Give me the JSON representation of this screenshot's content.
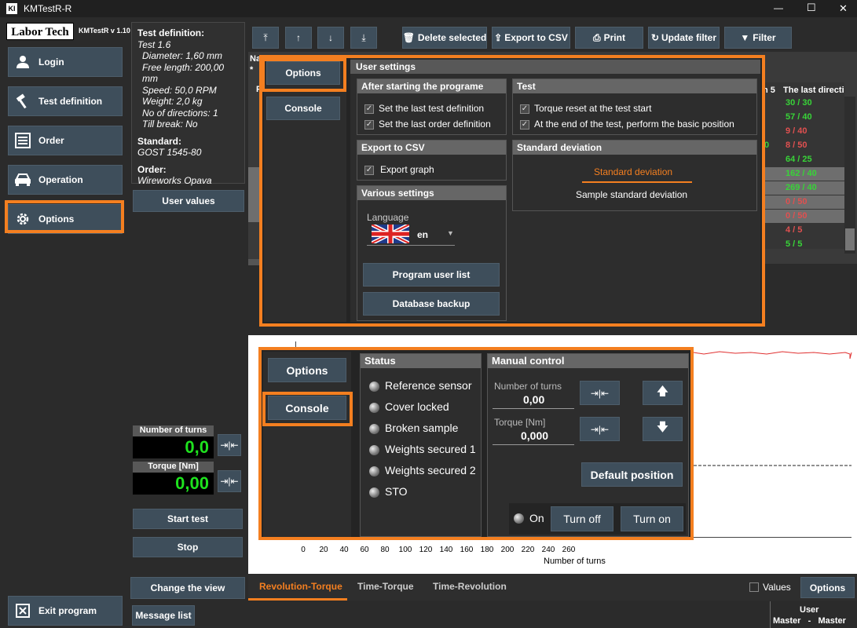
{
  "window": {
    "title": "KMTestR-R",
    "minimize": "—",
    "maximize": "☐",
    "close": "✕"
  },
  "logo": {
    "brand": "Labor Tech",
    "version": "KMTestR v 1.10"
  },
  "sidebar": {
    "items": [
      {
        "label": "Login",
        "icon": "user-icon"
      },
      {
        "label": "Test definition",
        "icon": "hammer-icon"
      },
      {
        "label": "Order",
        "icon": "order-list-icon"
      },
      {
        "label": "Operation",
        "icon": "car-icon"
      },
      {
        "label": "Options",
        "icon": "gear-icon"
      }
    ],
    "exit_label": "Exit program"
  },
  "test_info": {
    "heading": "Test definition:",
    "name": "Test 1.6",
    "diameter": "Diameter:  1,60 mm",
    "free_length": "Free length:  200,00 mm",
    "speed": "Speed:  50,0 RPM",
    "weight": "Weight:  2,0 kg",
    "directions": "No of directions:  1",
    "till_break": "Till break:  No",
    "standard_heading": "Standard:",
    "standard": "GOST 1545-80",
    "order_heading": "Order:",
    "order": "Wireworks Opava"
  },
  "user_values_label": "User values",
  "measurements": {
    "turns_label": "Number of turns",
    "turns_value": "0,0",
    "torque_label": "Torque [Nm]",
    "torque_value": "0,00"
  },
  "actions": {
    "start": "Start test",
    "stop": "Stop",
    "change_view": "Change the view",
    "message_list": "Message list"
  },
  "toolbar": {
    "delete": "Delete selected",
    "export": "Export to CSV",
    "print": "Print",
    "update": "Update filter",
    "filter": "Filter"
  },
  "table": {
    "header_partial_left": "Na",
    "header_partial_star": "*",
    "header_col_left": "F",
    "header_n5": "n 5",
    "header_last": "The last directi",
    "rows": [
      {
        "value": "30 / 30",
        "color": "#38d438",
        "extra": ""
      },
      {
        "value": "57 / 40",
        "color": "#38d438",
        "extra": ""
      },
      {
        "value": "9 / 40",
        "color": "#e05050",
        "extra": ""
      },
      {
        "value": "8 / 50",
        "color": "#e05050",
        "extra": "0"
      },
      {
        "value": "64 / 25",
        "color": "#38d438",
        "extra": ""
      },
      {
        "value": "162 / 40",
        "color": "#38d438",
        "extra": ""
      },
      {
        "value": "269 / 40",
        "color": "#38d438",
        "extra": ""
      },
      {
        "value": "0 / 50",
        "color": "#e05050",
        "extra": ""
      },
      {
        "value": "0 / 50",
        "color": "#e05050",
        "extra": ""
      },
      {
        "value": "4 / 5",
        "color": "#e05050",
        "extra": ""
      },
      {
        "value": "5 / 5",
        "color": "#38d438",
        "extra": ""
      }
    ]
  },
  "options_dialog": {
    "tab_options": "Options",
    "tab_console": "Console",
    "title": "User settings",
    "after_start": {
      "heading": "After starting the programe",
      "set_last_test": "Set the last test definition",
      "set_last_order": "Set the last order definition"
    },
    "test": {
      "heading": "Test",
      "torque_reset": "Torque reset at the test start",
      "basic_position": "At the end of the test, perform the basic position"
    },
    "export": {
      "heading": "Export to CSV",
      "export_graph": "Export graph"
    },
    "stddev": {
      "heading": "Standard deviation",
      "opt1": "Standard deviation",
      "opt2": "Sample standard deviation"
    },
    "various": {
      "heading": "Various settings",
      "language_label": "Language",
      "language_value": "en",
      "program_user_list": "Program user list",
      "database_backup": "Database backup"
    }
  },
  "console_dialog": {
    "tab_options": "Options",
    "tab_console": "Console",
    "status": {
      "heading": "Status",
      "items": [
        "Reference sensor",
        "Cover locked",
        "Broken sample",
        "Weights secured 1",
        "Weights secured 2",
        "STO"
      ]
    },
    "manual": {
      "heading": "Manual control",
      "turns_label": "Number of turns",
      "turns_value": "0,00",
      "torque_label": "Torque [Nm]",
      "torque_value": "0,000",
      "default_position": "Default position",
      "on_label": "On",
      "turn_off": "Turn off",
      "turn_on": "Turn on"
    }
  },
  "chart": {
    "x_ticks": [
      "0",
      "20",
      "40",
      "60",
      "80",
      "100",
      "120",
      "140",
      "160",
      "180",
      "200",
      "220",
      "240",
      "260"
    ],
    "xlabel": "Number of turns"
  },
  "chart_tabs": {
    "tab1": "Revolution-Torque",
    "tab2": "Time-Torque",
    "tab3": "Time-Revolution"
  },
  "bottom": {
    "values_label": "Values",
    "options_label": "Options"
  },
  "status_bar": {
    "user_label": "User",
    "user_value": "Master   -   Master"
  },
  "colors": {
    "accent": "#f47f20",
    "button": "#3e4e5b",
    "digit_green": "#1ee21e"
  }
}
